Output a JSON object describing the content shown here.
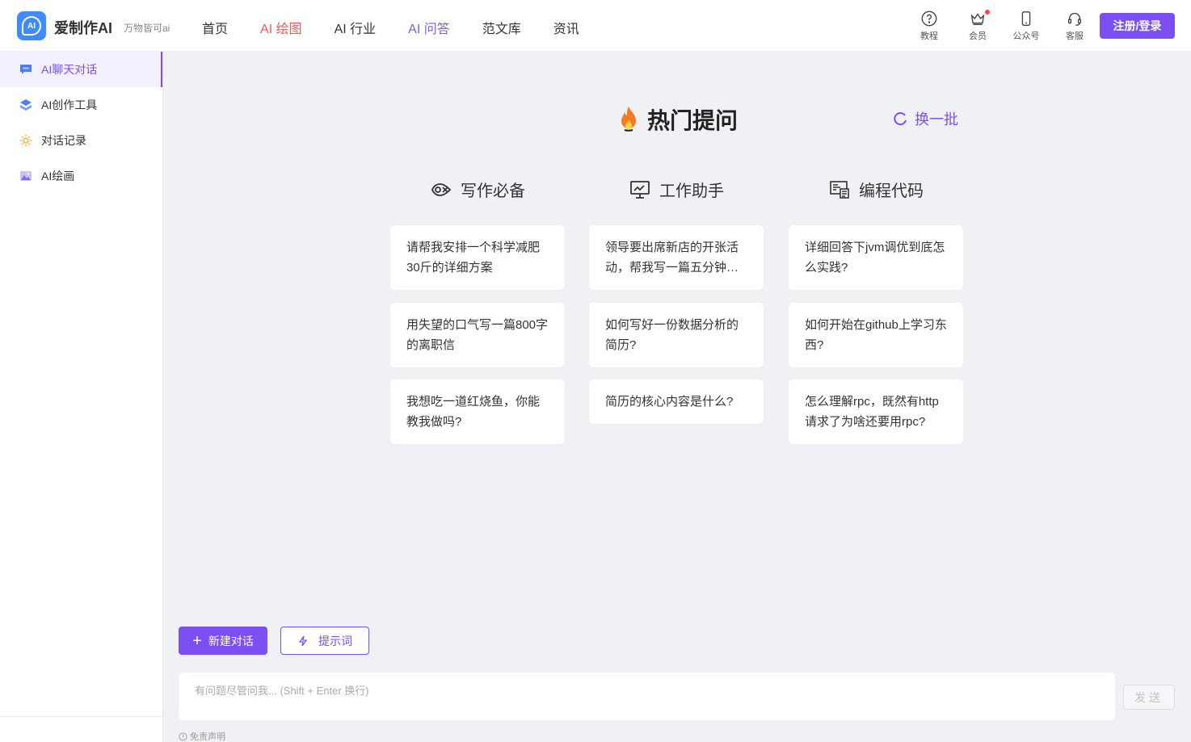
{
  "header": {
    "brand_icon_text": "AI",
    "brand_name": "爱制作AI",
    "brand_slogan": "万物皆可ai",
    "nav": [
      {
        "label": "首页"
      },
      {
        "label": "AI 绘图"
      },
      {
        "label": "AI 行业"
      },
      {
        "label": "AI 问答"
      },
      {
        "label": "范文库"
      },
      {
        "label": "资讯"
      }
    ],
    "tools": [
      {
        "label": "教程",
        "icon": "help-circle-icon"
      },
      {
        "label": "会员",
        "icon": "crown-icon"
      },
      {
        "label": "公众号",
        "icon": "phone-icon"
      },
      {
        "label": "客服",
        "icon": "headset-icon"
      }
    ],
    "login_label": "注册/登录"
  },
  "sidebar": {
    "items": [
      {
        "label": "AI聊天对话",
        "icon": "chat-icon",
        "active": true
      },
      {
        "label": "AI创作工具",
        "icon": "layers-icon"
      },
      {
        "label": "对话记录",
        "icon": "sun-icon"
      },
      {
        "label": "AI绘画",
        "icon": "image-icon"
      }
    ]
  },
  "main": {
    "hot_title": "热门提问",
    "refresh_label": "换一批",
    "columns": [
      {
        "title": "写作必备",
        "icon": "writing-icon",
        "cards": [
          "请帮我安排一个科学减肥30斤的详细方案",
          "用失望的口气写一篇800字的离职信",
          "我想吃一道红烧鱼，你能教我做吗?"
        ]
      },
      {
        "title": "工作助手",
        "icon": "monitor-icon",
        "cards": [
          "领导要出席新店的开张活动，帮我写一篇五分钟的致辞",
          "如何写好一份数据分析的简历?",
          "简历的核心内容是什么?"
        ]
      },
      {
        "title": "编程代码",
        "icon": "code-icon",
        "cards": [
          "详细回答下jvm调优到底怎么实践?",
          "如何开始在github上学习东西?",
          "怎么理解rpc，既然有http请求了为啥还要用rpc?"
        ]
      }
    ]
  },
  "bottom": {
    "new_chat_label": "新建对话",
    "prompt_label": "提示词",
    "input_placeholder": "有问题尽管问我... (Shift + Enter 换行)",
    "send_label": "发送",
    "disclaimer_label": "免责声明"
  },
  "colors": {
    "accent": "#7b4ff2",
    "nav_red": "#f05a5a",
    "brand_blue": "#3d8bfd",
    "background": "#f0f1f5"
  }
}
